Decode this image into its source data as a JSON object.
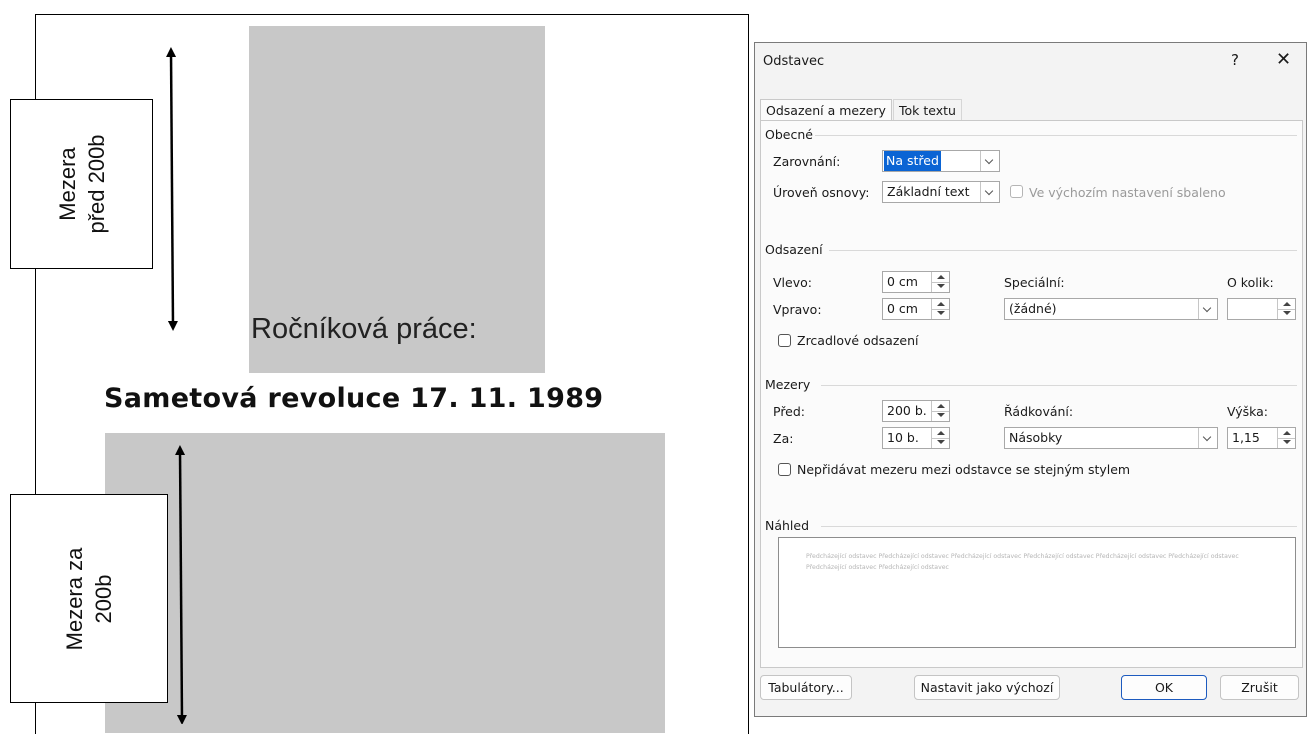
{
  "illustration": {
    "subtitle": "Ročníková práce:",
    "title": "Sametová revoluce 17. 11. 1989",
    "note_top": [
      "Mezera",
      "před 200b"
    ],
    "note_bottom": [
      "Mezera za",
      "200b"
    ]
  },
  "dialog": {
    "title": "Odstavec",
    "help": "?",
    "close": "✕",
    "tabs": [
      "Odsazení a mezery",
      "Tok textu"
    ],
    "general": {
      "heading": "Obecné",
      "alignment_label": "Zarovnání:",
      "alignment_value": "Na střed",
      "outline_label": "Úroveň osnovy:",
      "outline_value": "Základní text",
      "collapsed_label": "Ve výchozím nastavení sbaleno"
    },
    "indentation": {
      "heading": "Odsazení",
      "left_label": "Vlevo:",
      "left_value": "0 cm",
      "right_label": "Vpravo:",
      "right_value": "0 cm",
      "special_label": "Speciální:",
      "special_value": "(žádné)",
      "by_label": "O kolik:",
      "by_value": "",
      "mirror_label": "Zrcadlové odsazení"
    },
    "spacing": {
      "heading": "Mezery",
      "before_label": "Před:",
      "before_value": "200 b.",
      "after_label": "Za:",
      "after_value": "10 b.",
      "line_label": "Řádkování:",
      "line_value": "Násobky",
      "at_label": "Výška:",
      "at_value": "1,15",
      "no_space_label": "Nepřidávat mezeru mezi odstavce se stejným stylem"
    },
    "preview": {
      "heading": "Náhled",
      "text": "Předcházející odstavec Předcházející odstavec Předcházející odstavec Předcházející odstavec Předcházející odstavec Předcházející odstavec Předcházející odstavec Předcházející odstavec"
    },
    "buttons": {
      "tabs": "Tabulátory...",
      "default": "Nastavit jako výchozí",
      "ok": "OK",
      "cancel": "Zrušit"
    }
  }
}
